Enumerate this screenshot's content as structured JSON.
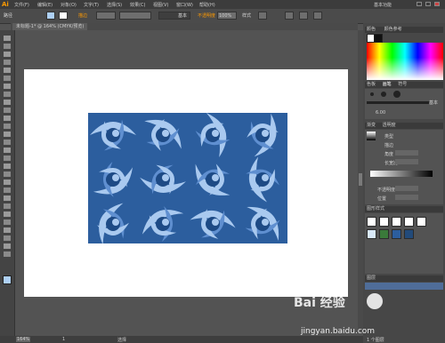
{
  "app": {
    "logo": "Ai"
  },
  "menu": [
    "文件(F)",
    "编辑(E)",
    "对象(O)",
    "文字(T)",
    "选择(S)",
    "效果(C)",
    "视图(V)",
    "窗口(W)",
    "帮助(H)"
  ],
  "workspace": "基本功能",
  "control_bar": {
    "selection_label": "路径",
    "stroke_label": "描边",
    "stroke_style": "基本",
    "opacity_label": "不透明度",
    "opacity_value": "100%",
    "style_label": "样式"
  },
  "document_tab": "未标题-1* @ 164% (CMYK/预览)",
  "status": {
    "zoom": "164%",
    "page": "1",
    "tool": "选择"
  },
  "panels": {
    "color_tab": "颜色",
    "color_ref_tab": "颜色参考",
    "brush_tabs": [
      "色板",
      "画笔",
      "符号"
    ],
    "brush_size": "6.00",
    "brush_basic": "基本",
    "stroke_panel_label": "描边",
    "gradient_label": "类型",
    "transparency": [
      "渐变",
      "透明度"
    ],
    "gradient_labels": [
      "描边",
      "角度",
      "长宽比",
      "不透明度",
      "位置"
    ],
    "graphic_styles": "图形样式",
    "layers_label": "图层",
    "layers_footer": "1 个图层"
  },
  "watermark": {
    "brand": "Bai 经验",
    "url": "jingyan.baidu.com"
  },
  "colors": {
    "accent": "#ff9a00",
    "pattern_dark": "#2c5e9e",
    "pattern_light": "#a9c9ef"
  }
}
